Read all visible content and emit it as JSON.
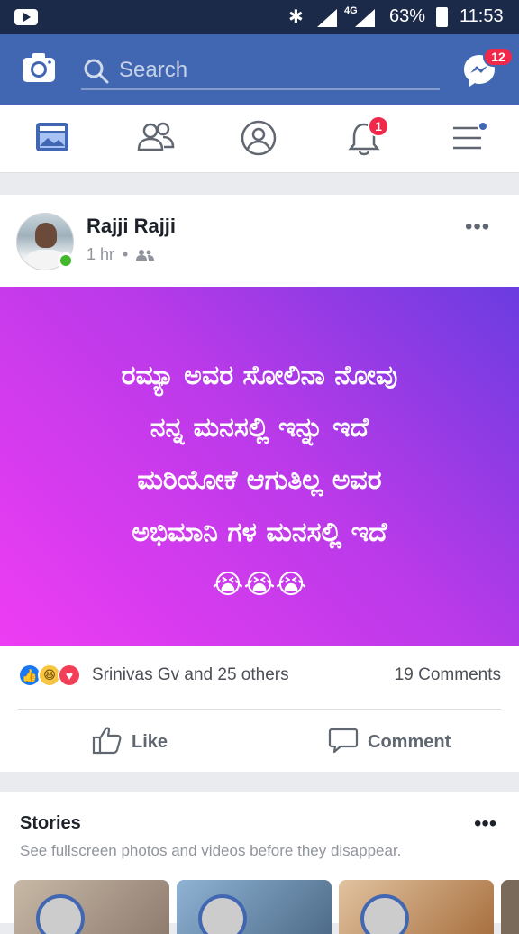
{
  "status_bar": {
    "network": "4G",
    "battery": "63%",
    "time": "11:53"
  },
  "header": {
    "search_placeholder": "Search",
    "messenger_badge": "12"
  },
  "nav": {
    "notifications_badge": "1",
    "items": [
      "news-feed",
      "friends",
      "profile",
      "notifications",
      "menu"
    ]
  },
  "post": {
    "author": "Rajji Rajji",
    "time": "1 hr",
    "separator": "•",
    "text_lines": [
      "ರಮ್ಯಾ ಅವರ ಸೋಲಿನಾ ನೋವು",
      "ನನ್ನ ಮನಸಲ್ಲಿ ಇನ್ನು ಇದೆ",
      "ಮರಿಯೋಕೆ ಆಗುತಿಲ್ಲ  ಅವರ",
      "ಅಭಿಮಾನಿ ಗಳ ಮನಸಲ್ಲಿ ಇದೆ",
      "😭😭😭"
    ],
    "reactions_text": "Srinivas Gv and 25 others",
    "comments_count": "19 Comments",
    "like_label": "Like",
    "comment_label": "Comment",
    "banner_colors": [
      "#6a3ce0",
      "#ee3cf3"
    ]
  },
  "stories": {
    "title": "Stories",
    "subtitle": "See fullscreen photos and videos before they disappear."
  },
  "colors": {
    "brand": "#4267b2",
    "badge": "#f02849",
    "online": "#42b72a"
  }
}
